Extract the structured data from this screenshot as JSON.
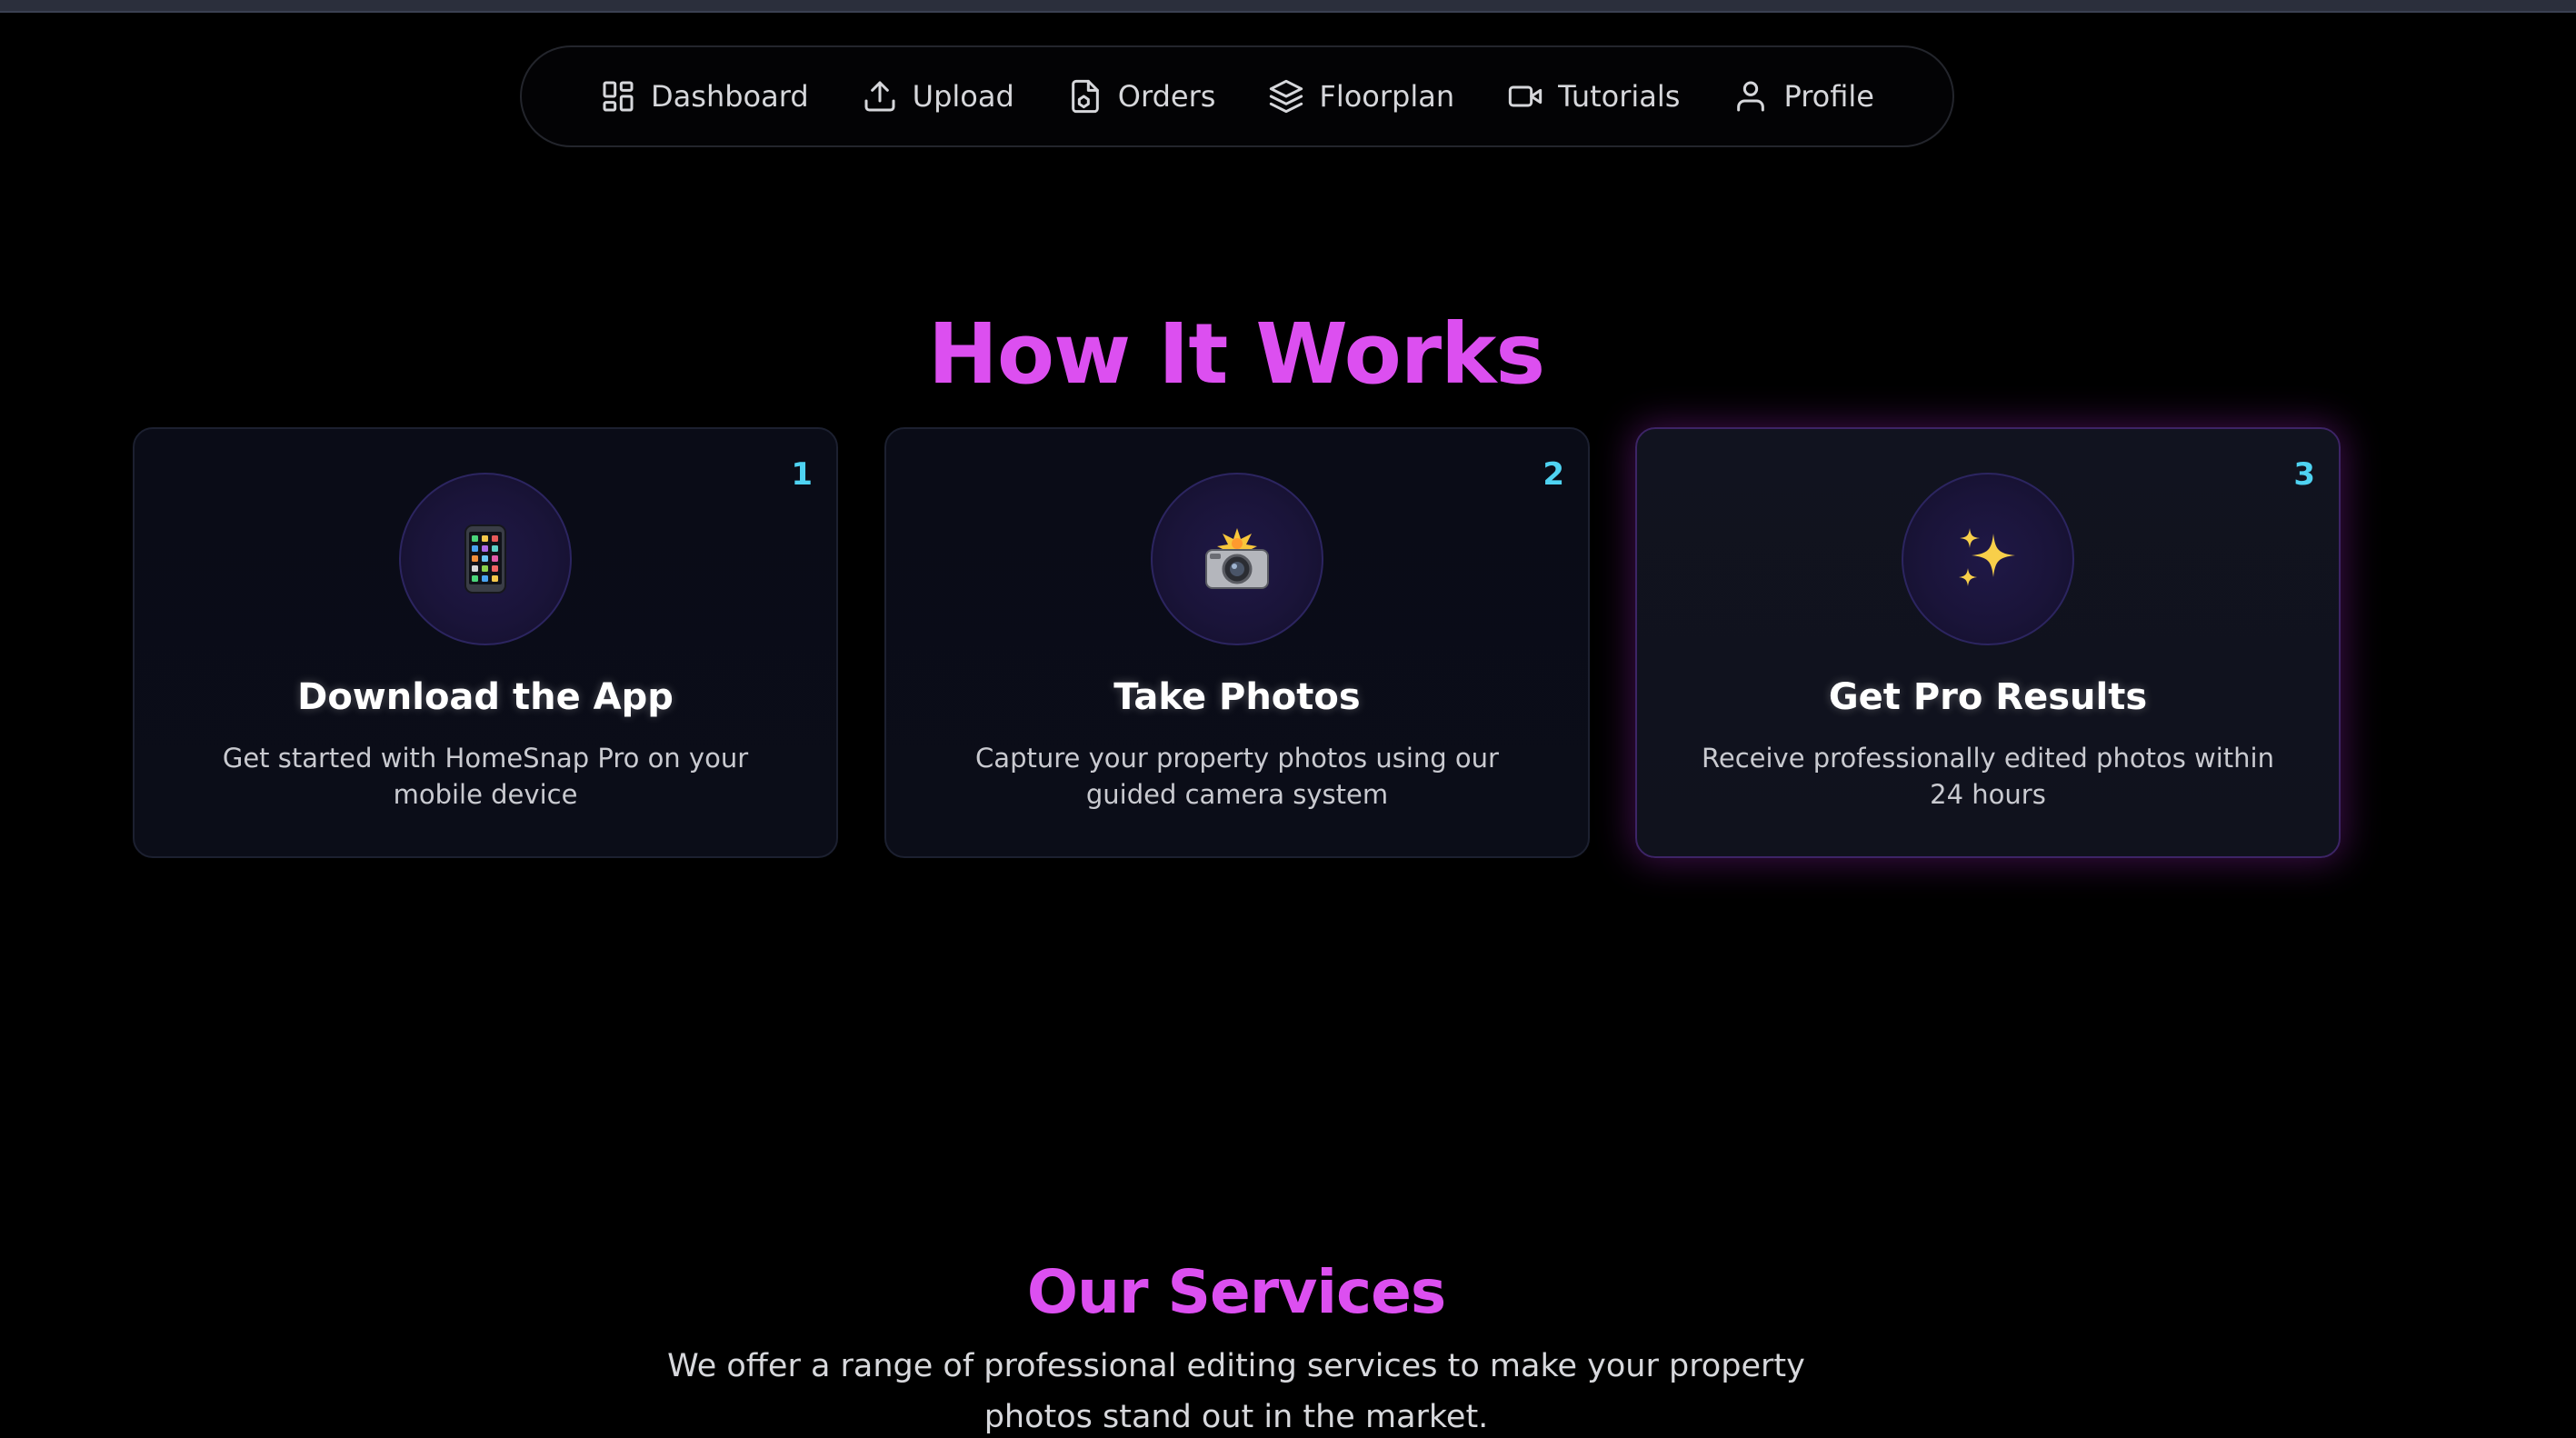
{
  "nav": {
    "items": [
      {
        "label": "Dashboard",
        "icon": "dashboard-icon"
      },
      {
        "label": "Upload",
        "icon": "upload-icon"
      },
      {
        "label": "Orders",
        "icon": "orders-icon"
      },
      {
        "label": "Floorplan",
        "icon": "layers-icon"
      },
      {
        "label": "Tutorials",
        "icon": "video-camera-icon"
      },
      {
        "label": "Profile",
        "icon": "user-icon"
      }
    ]
  },
  "how_it_works": {
    "title": "How It Works",
    "steps": [
      {
        "number": "1",
        "icon": "mobile-phone-icon",
        "title": "Download the App",
        "description": "Get started with HomeSnap Pro on your mobile device"
      },
      {
        "number": "2",
        "icon": "camera-flash-icon",
        "title": "Take Photos",
        "description": "Capture your property photos using our guided camera system"
      },
      {
        "number": "3",
        "icon": "sparkles-icon",
        "title": "Get Pro Results",
        "description": "Receive professionally edited photos within 24 hours"
      }
    ]
  },
  "services": {
    "title": "Our Services",
    "description": "We offer a range of professional editing services to make your property photos stand out in the market."
  },
  "colors": {
    "background": "#000000",
    "heading": "#dc4ff0",
    "step_number": "#4fd3f2",
    "highlight_glow": "#aa28c8"
  }
}
